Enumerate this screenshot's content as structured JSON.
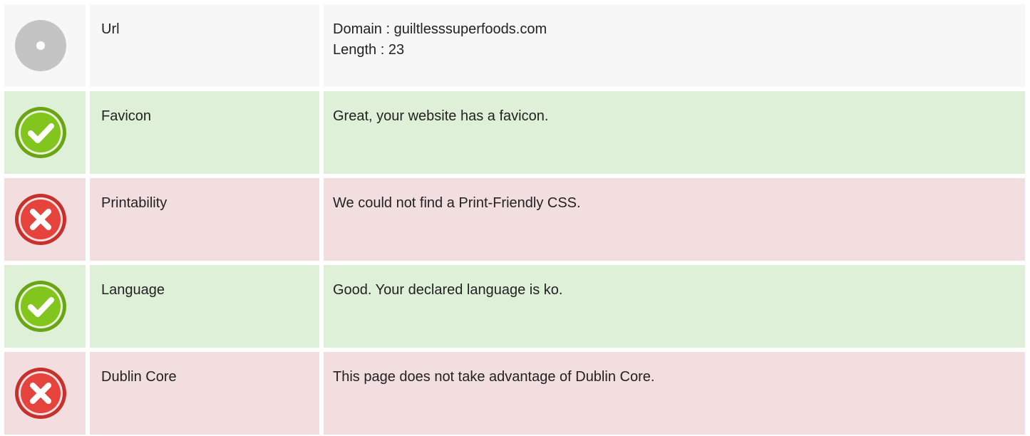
{
  "rows": [
    {
      "status": "neutral",
      "icon": "neutral-dot-icon",
      "label": "Url",
      "details": [
        "Domain : guiltlesssuperfoods.com",
        "Length : 23"
      ]
    },
    {
      "status": "pass",
      "icon": "check-icon",
      "label": "Favicon",
      "details": [
        "Great, your website has a favicon."
      ]
    },
    {
      "status": "fail",
      "icon": "x-icon",
      "label": "Printability",
      "details": [
        "We could not find a Print-Friendly CSS."
      ]
    },
    {
      "status": "pass",
      "icon": "check-icon",
      "label": "Language",
      "details": [
        "Good. Your declared language is ko."
      ]
    },
    {
      "status": "fail",
      "icon": "x-icon",
      "label": "Dublin Core",
      "details": [
        "This page does not take advantage of Dublin Core."
      ]
    }
  ],
  "colors": {
    "neutral_bg": "#f7f7f7",
    "pass_bg": "#dff0d8",
    "fail_bg": "#f2dede",
    "pass_icon": "#7dc11c",
    "fail_icon": "#e2403a",
    "neutral_icon": "#c4c4c4"
  }
}
